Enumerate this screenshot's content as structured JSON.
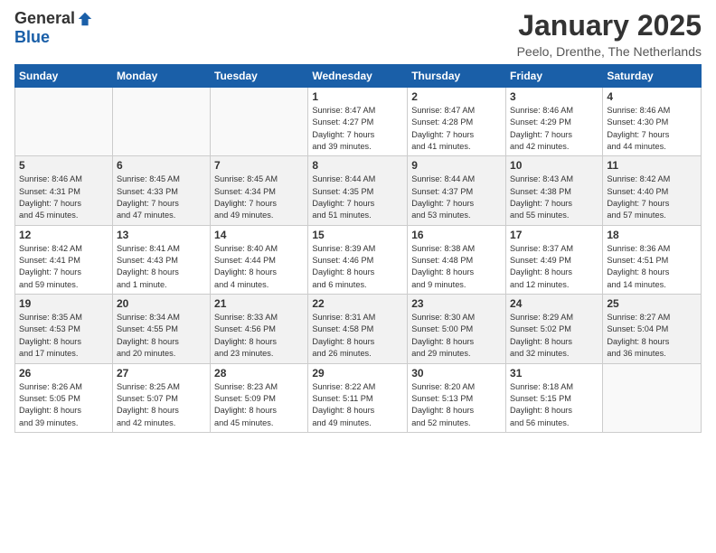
{
  "header": {
    "logo_general": "General",
    "logo_blue": "Blue",
    "month": "January 2025",
    "location": "Peelo, Drenthe, The Netherlands"
  },
  "weekdays": [
    "Sunday",
    "Monday",
    "Tuesday",
    "Wednesday",
    "Thursday",
    "Friday",
    "Saturday"
  ],
  "weeks": [
    [
      {
        "day": "",
        "info": ""
      },
      {
        "day": "",
        "info": ""
      },
      {
        "day": "",
        "info": ""
      },
      {
        "day": "1",
        "info": "Sunrise: 8:47 AM\nSunset: 4:27 PM\nDaylight: 7 hours\nand 39 minutes."
      },
      {
        "day": "2",
        "info": "Sunrise: 8:47 AM\nSunset: 4:28 PM\nDaylight: 7 hours\nand 41 minutes."
      },
      {
        "day": "3",
        "info": "Sunrise: 8:46 AM\nSunset: 4:29 PM\nDaylight: 7 hours\nand 42 minutes."
      },
      {
        "day": "4",
        "info": "Sunrise: 8:46 AM\nSunset: 4:30 PM\nDaylight: 7 hours\nand 44 minutes."
      }
    ],
    [
      {
        "day": "5",
        "info": "Sunrise: 8:46 AM\nSunset: 4:31 PM\nDaylight: 7 hours\nand 45 minutes."
      },
      {
        "day": "6",
        "info": "Sunrise: 8:45 AM\nSunset: 4:33 PM\nDaylight: 7 hours\nand 47 minutes."
      },
      {
        "day": "7",
        "info": "Sunrise: 8:45 AM\nSunset: 4:34 PM\nDaylight: 7 hours\nand 49 minutes."
      },
      {
        "day": "8",
        "info": "Sunrise: 8:44 AM\nSunset: 4:35 PM\nDaylight: 7 hours\nand 51 minutes."
      },
      {
        "day": "9",
        "info": "Sunrise: 8:44 AM\nSunset: 4:37 PM\nDaylight: 7 hours\nand 53 minutes."
      },
      {
        "day": "10",
        "info": "Sunrise: 8:43 AM\nSunset: 4:38 PM\nDaylight: 7 hours\nand 55 minutes."
      },
      {
        "day": "11",
        "info": "Sunrise: 8:42 AM\nSunset: 4:40 PM\nDaylight: 7 hours\nand 57 minutes."
      }
    ],
    [
      {
        "day": "12",
        "info": "Sunrise: 8:42 AM\nSunset: 4:41 PM\nDaylight: 7 hours\nand 59 minutes."
      },
      {
        "day": "13",
        "info": "Sunrise: 8:41 AM\nSunset: 4:43 PM\nDaylight: 8 hours\nand 1 minute."
      },
      {
        "day": "14",
        "info": "Sunrise: 8:40 AM\nSunset: 4:44 PM\nDaylight: 8 hours\nand 4 minutes."
      },
      {
        "day": "15",
        "info": "Sunrise: 8:39 AM\nSunset: 4:46 PM\nDaylight: 8 hours\nand 6 minutes."
      },
      {
        "day": "16",
        "info": "Sunrise: 8:38 AM\nSunset: 4:48 PM\nDaylight: 8 hours\nand 9 minutes."
      },
      {
        "day": "17",
        "info": "Sunrise: 8:37 AM\nSunset: 4:49 PM\nDaylight: 8 hours\nand 12 minutes."
      },
      {
        "day": "18",
        "info": "Sunrise: 8:36 AM\nSunset: 4:51 PM\nDaylight: 8 hours\nand 14 minutes."
      }
    ],
    [
      {
        "day": "19",
        "info": "Sunrise: 8:35 AM\nSunset: 4:53 PM\nDaylight: 8 hours\nand 17 minutes."
      },
      {
        "day": "20",
        "info": "Sunrise: 8:34 AM\nSunset: 4:55 PM\nDaylight: 8 hours\nand 20 minutes."
      },
      {
        "day": "21",
        "info": "Sunrise: 8:33 AM\nSunset: 4:56 PM\nDaylight: 8 hours\nand 23 minutes."
      },
      {
        "day": "22",
        "info": "Sunrise: 8:31 AM\nSunset: 4:58 PM\nDaylight: 8 hours\nand 26 minutes."
      },
      {
        "day": "23",
        "info": "Sunrise: 8:30 AM\nSunset: 5:00 PM\nDaylight: 8 hours\nand 29 minutes."
      },
      {
        "day": "24",
        "info": "Sunrise: 8:29 AM\nSunset: 5:02 PM\nDaylight: 8 hours\nand 32 minutes."
      },
      {
        "day": "25",
        "info": "Sunrise: 8:27 AM\nSunset: 5:04 PM\nDaylight: 8 hours\nand 36 minutes."
      }
    ],
    [
      {
        "day": "26",
        "info": "Sunrise: 8:26 AM\nSunset: 5:05 PM\nDaylight: 8 hours\nand 39 minutes."
      },
      {
        "day": "27",
        "info": "Sunrise: 8:25 AM\nSunset: 5:07 PM\nDaylight: 8 hours\nand 42 minutes."
      },
      {
        "day": "28",
        "info": "Sunrise: 8:23 AM\nSunset: 5:09 PM\nDaylight: 8 hours\nand 45 minutes."
      },
      {
        "day": "29",
        "info": "Sunrise: 8:22 AM\nSunset: 5:11 PM\nDaylight: 8 hours\nand 49 minutes."
      },
      {
        "day": "30",
        "info": "Sunrise: 8:20 AM\nSunset: 5:13 PM\nDaylight: 8 hours\nand 52 minutes."
      },
      {
        "day": "31",
        "info": "Sunrise: 8:18 AM\nSunset: 5:15 PM\nDaylight: 8 hours\nand 56 minutes."
      },
      {
        "day": "",
        "info": ""
      }
    ]
  ]
}
